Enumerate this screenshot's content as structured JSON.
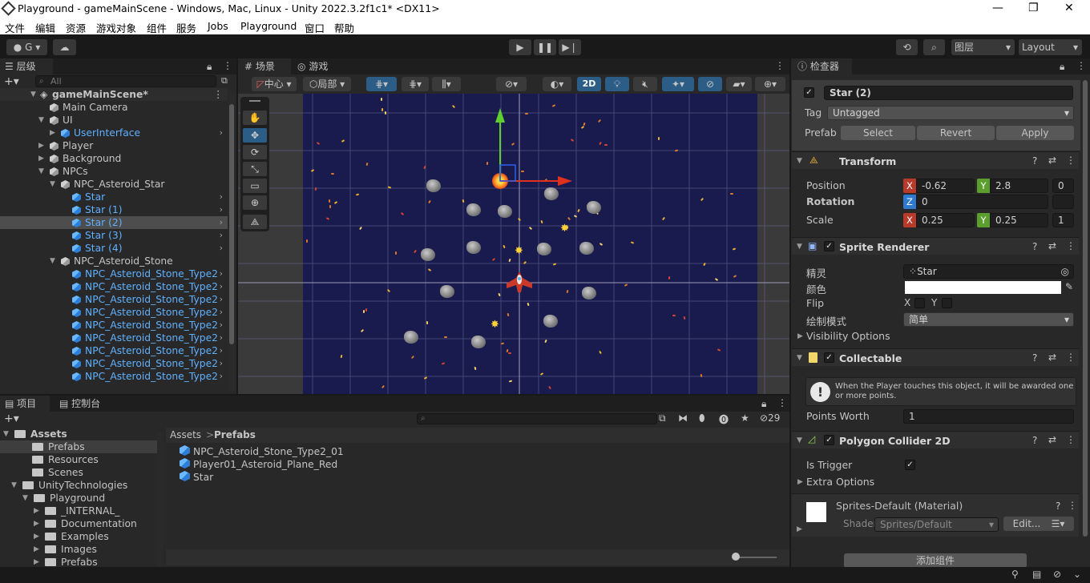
{
  "window": {
    "title": "Playground - gameMainScene - Windows, Mac, Linux - Unity 2022.3.2f1c1* <DX11>",
    "minimize": "—",
    "maximize": "❐",
    "close": "✕"
  },
  "menu": [
    "文件",
    "编辑",
    "资源",
    "游戏对象",
    "组件",
    "服务",
    "Jobs",
    "Playground",
    "窗口",
    "帮助"
  ],
  "toolbar": {
    "account": "G",
    "layers_label": "图层",
    "layout_label": "Layout"
  },
  "hierarchy": {
    "tab": "层级",
    "search_placeholder": "All",
    "scene": "gameMainScene*",
    "rows": [
      {
        "label": "Main Camera",
        "blue": false
      },
      {
        "label": "UI",
        "blue": false
      },
      {
        "label": "UserInterface",
        "blue": true
      },
      {
        "label": "Player",
        "blue": false
      },
      {
        "label": "Background",
        "blue": false
      },
      {
        "label": "NPCs",
        "blue": false
      },
      {
        "label": "NPC_Asteroid_Star",
        "blue": false
      },
      {
        "label": "Star",
        "blue": true
      },
      {
        "label": "Star (1)",
        "blue": true
      },
      {
        "label": "Star (2)",
        "blue": true
      },
      {
        "label": "Star (3)",
        "blue": true
      },
      {
        "label": "Star (4)",
        "blue": true
      },
      {
        "label": "NPC_Asteroid_Stone",
        "blue": false
      },
      {
        "label": "NPC_Asteroid_Stone_Type2",
        "blue": true
      },
      {
        "label": "NPC_Asteroid_Stone_Type2",
        "blue": true
      },
      {
        "label": "NPC_Asteroid_Stone_Type2",
        "blue": true
      },
      {
        "label": "NPC_Asteroid_Stone_Type2",
        "blue": true
      },
      {
        "label": "NPC_Asteroid_Stone_Type2",
        "blue": true
      },
      {
        "label": "NPC_Asteroid_Stone_Type2",
        "blue": true
      },
      {
        "label": "NPC_Asteroid_Stone_Type2",
        "blue": true
      },
      {
        "label": "NPC_Asteroid_Stone_Type2",
        "blue": true
      },
      {
        "label": "NPC_Asteroid_Stone_Type2",
        "blue": true
      }
    ]
  },
  "scene": {
    "tab_scene": "场景",
    "tab_game": "游戏",
    "pivot": "中心",
    "space": "局部",
    "mode_2d": "2D"
  },
  "inspector": {
    "tab": "检查器",
    "object_name": "Star (2)",
    "tag_label": "Tag",
    "tag_value": "Untagged",
    "prefab_label": "Prefab",
    "prefab_select": "Select",
    "prefab_revert": "Revert",
    "prefab_apply": "Apply",
    "transform": {
      "title": "Transform",
      "position_label": "Position",
      "rotation_label": "Rotation",
      "scale_label": "Scale",
      "pos_x": "-0.62",
      "pos_y": "2.8",
      "pos_z": "0",
      "rot_z": "0",
      "scale_x": "0.25",
      "scale_y": "0.25",
      "scale_z": "1"
    },
    "sprite_renderer": {
      "title": "Sprite Renderer",
      "sprite_label": "精灵",
      "sprite_value": "Star",
      "color_label": "颜色",
      "flip_label": "Flip",
      "flip_x": "X",
      "flip_y": "Y",
      "draw_mode_label": "绘制模式",
      "draw_mode_value": "简单",
      "visibility": "Visibility Options"
    },
    "collectable": {
      "title": "Collectable",
      "info": "When the Player touches this object, it will be awarded one or more points.",
      "points_label": "Points Worth",
      "points_value": "1"
    },
    "polygon_collider": {
      "title": "Polygon Collider 2D",
      "trigger_label": "Is Trigger",
      "extra": "Extra Options"
    },
    "material": {
      "title": "Sprites-Default (Material)",
      "shader_label": "Shader",
      "shader_value": "Sprites/Default",
      "edit": "Edit..."
    },
    "add_component": "添加组件"
  },
  "project": {
    "tab_project": "项目",
    "tab_console": "控制台",
    "breadcrumb_root": "Assets",
    "breadcrumb_sep": ">",
    "breadcrumb_current": "Prefabs",
    "hidden_count": "29",
    "tree": [
      {
        "label": "Assets",
        "bold": true
      },
      {
        "label": "Prefabs",
        "bold": false
      },
      {
        "label": "Resources",
        "bold": false
      },
      {
        "label": "Scenes",
        "bold": false
      },
      {
        "label": "UnityTechnologies",
        "bold": false
      },
      {
        "label": "Playground",
        "bold": false
      },
      {
        "label": "_INTERNAL_",
        "bold": false
      },
      {
        "label": "Documentation",
        "bold": false
      },
      {
        "label": "Examples",
        "bold": false
      },
      {
        "label": "Images",
        "bold": false
      },
      {
        "label": "Prefabs",
        "bold": false
      }
    ],
    "files": [
      "NPC_Asteroid_Stone_Type2_01",
      "Player01_Asteroid_Plane_Red",
      "Star"
    ]
  },
  "colors": {
    "accent": "#2c5d87",
    "selected_row": "#4d4d4d",
    "scene_bg": "#191a4e",
    "axis_x": "#c0392b",
    "axis_y": "#5b9e2e",
    "axis_z": "#2f7ad1"
  }
}
